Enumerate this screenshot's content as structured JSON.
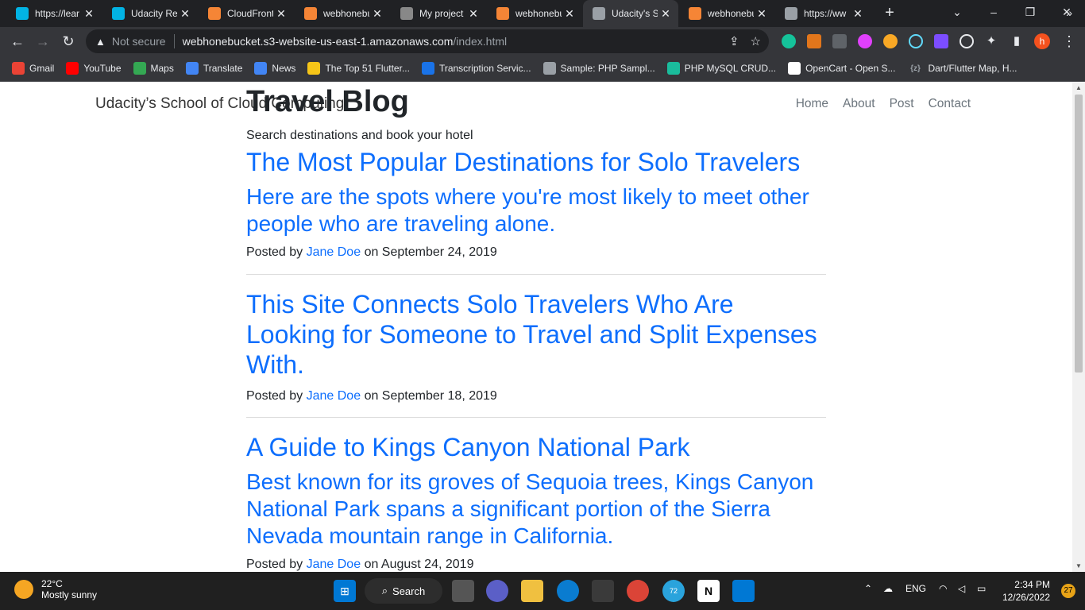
{
  "browser": {
    "tabs": [
      {
        "title": "https://lear",
        "favicon": "udacity-icon",
        "color": "#02b3e4"
      },
      {
        "title": "Udacity Re",
        "favicon": "udacity-icon",
        "color": "#02b3e4"
      },
      {
        "title": "CloudFront",
        "favicon": "aws-icon",
        "color": "#f58536"
      },
      {
        "title": "webhonebu",
        "favicon": "aws-icon",
        "color": "#f58536"
      },
      {
        "title": "My project",
        "favicon": "github-icon",
        "color": "#888888"
      },
      {
        "title": "webhonebu",
        "favicon": "aws-icon",
        "color": "#f58536"
      },
      {
        "title": "Udacity's S",
        "favicon": "globe-icon",
        "color": "#9aa0a6",
        "active": true
      },
      {
        "title": "webhonebu",
        "favicon": "aws-icon",
        "color": "#f58536"
      },
      {
        "title": "https://ww",
        "favicon": "globe-icon",
        "color": "#9aa0a6"
      }
    ],
    "security_label": "Not secure",
    "url_host": "webhonebucket.s3-website-us-east-1.amazonaws.com",
    "url_path": "/index.html",
    "profile_initial": "h",
    "bookmarks": [
      {
        "label": "Gmail",
        "icon": "gmail-icon",
        "color": "#ea4335"
      },
      {
        "label": "YouTube",
        "icon": "youtube-icon",
        "color": "#ff0000"
      },
      {
        "label": "Maps",
        "icon": "maps-icon",
        "color": "#34a853"
      },
      {
        "label": "Translate",
        "icon": "translate-icon",
        "color": "#4285f4"
      },
      {
        "label": "News",
        "icon": "news-icon",
        "color": "#4285f4"
      },
      {
        "label": "The Top 51 Flutter...",
        "icon": "emoji-icon",
        "color": "#f5c518"
      },
      {
        "label": "Transcription Servic...",
        "icon": "g-icon",
        "color": "#1a73e8"
      },
      {
        "label": "Sample: PHP Sampl...",
        "icon": "globe-icon",
        "color": "#9aa0a6"
      },
      {
        "label": "PHP MySQL CRUD...",
        "icon": "shield-icon",
        "color": "#1abc9c"
      },
      {
        "label": "OpenCart - Open S...",
        "icon": "cart-icon",
        "color": "#ffffff"
      },
      {
        "label": "Dart/Flutter Map, H...",
        "icon": "bracket-icon",
        "color": "#9aa0a6",
        "glyph": "{z}"
      }
    ]
  },
  "site": {
    "brand": "Udacity’s School of Cloud Computing",
    "nav": [
      "Home",
      "About",
      "Post",
      "Contact"
    ],
    "heading": "Travel Blog",
    "subheading": "Search destinations and book your hotel"
  },
  "posts": [
    {
      "title": "The Most Popular Destinations for Solo Travelers",
      "subtitle": "Here are the spots where you're most likely to meet other people who are traveling alone.",
      "posted_by": "Posted by",
      "author": "Jane Doe",
      "date": "on September 24, 2019"
    },
    {
      "title": "This Site Connects Solo Travelers Who Are Looking for Someone to Travel and Split Expenses With.",
      "subtitle": "",
      "posted_by": "Posted by",
      "author": "Jane Doe",
      "date": "on September 18, 2019"
    },
    {
      "title": "A Guide to Kings Canyon National Park",
      "subtitle": "Best known for its groves of Sequoia trees, Kings Canyon National Park spans a significant portion of the Sierra Nevada mountain range in California.",
      "posted_by": "Posted by",
      "author": "Jane Doe",
      "date": "on August 24, 2019"
    }
  ],
  "taskbar": {
    "temp": "22°C",
    "weather": "Mostly sunny",
    "search_label": "Search",
    "lang": "ENG",
    "time": "2:34 PM",
    "date": "12/26/2022",
    "notifications": "27",
    "telegram_badge": "72"
  }
}
